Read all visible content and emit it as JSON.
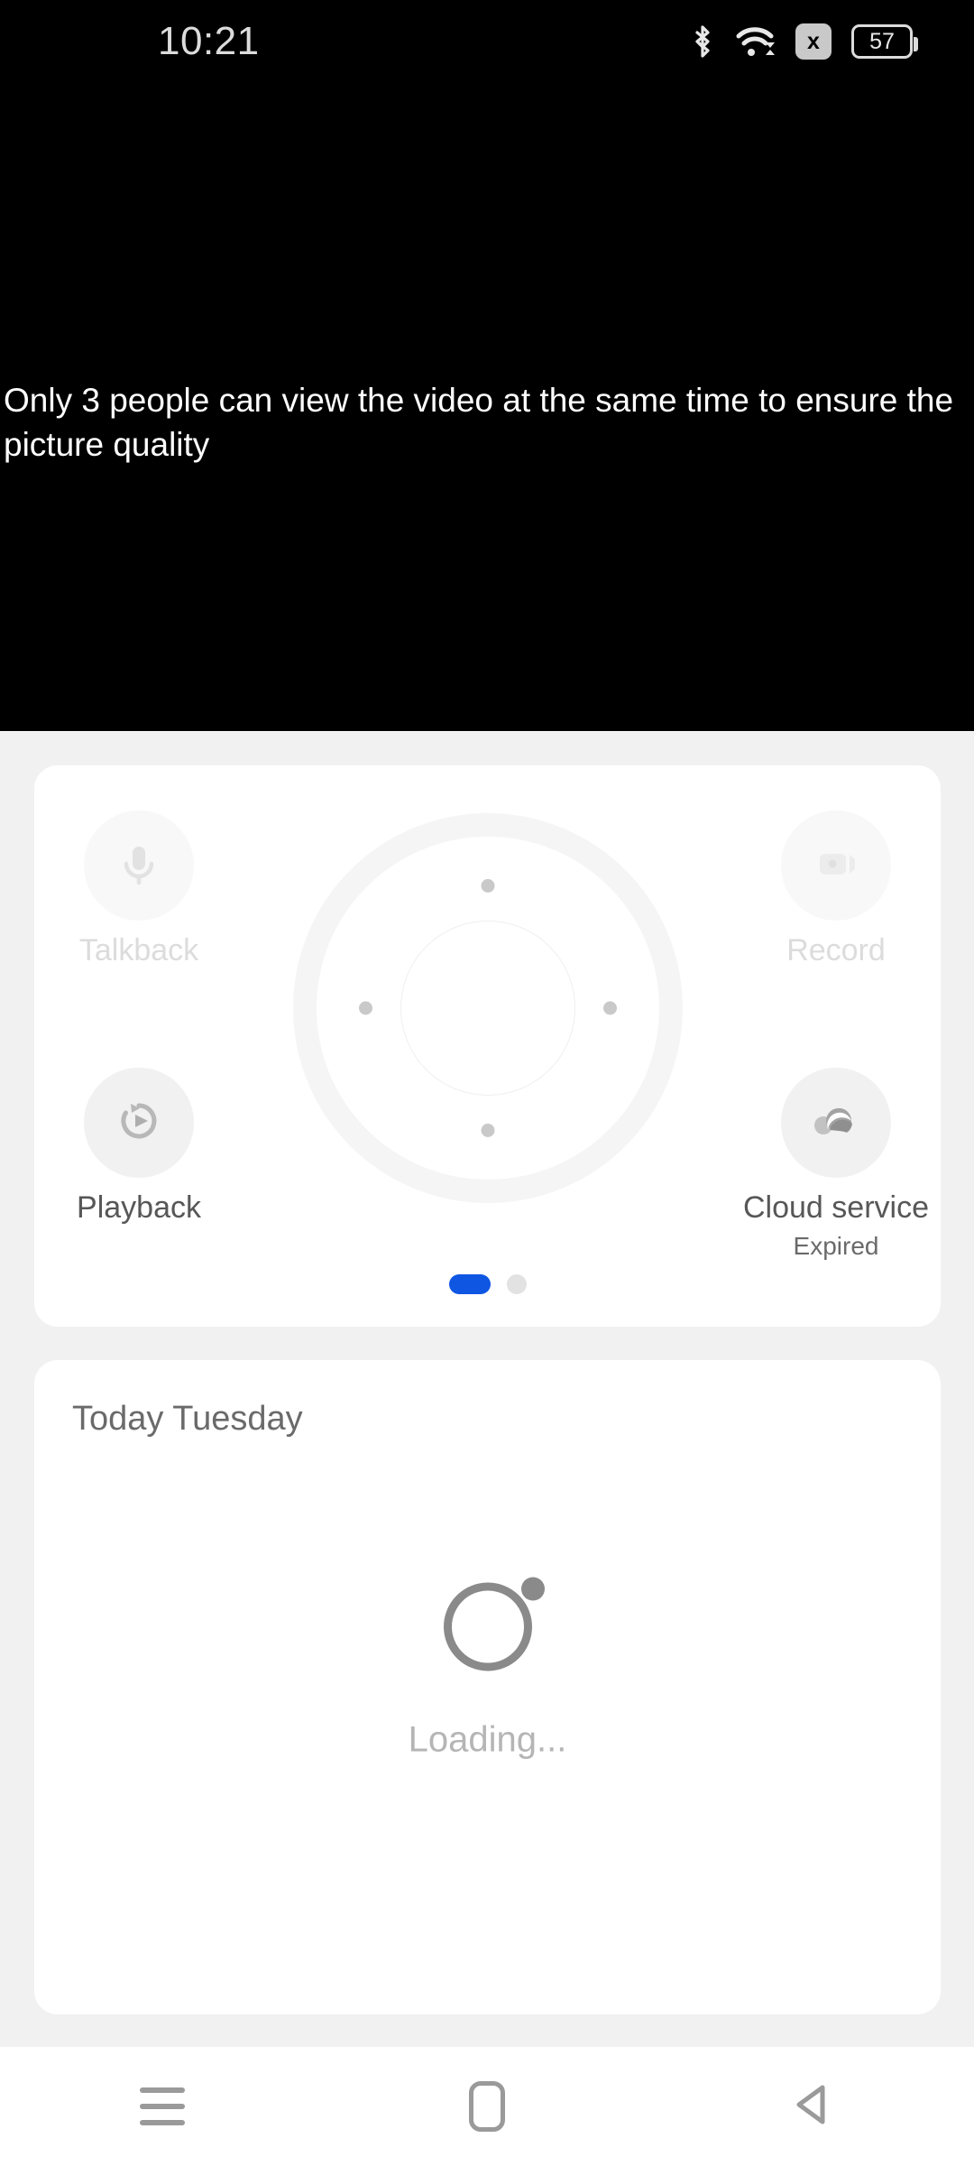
{
  "status_bar": {
    "time": "10:21",
    "bluetooth_icon": "bluetooth-icon",
    "wifi_icon": "wifi-icon",
    "no_signal_icon": "x",
    "battery_level": "57"
  },
  "video": {
    "message": "Only 3 people can view the video at the same time to ensure the picture quality",
    "background_color": "#000000"
  },
  "controls": {
    "talkback": {
      "label": "Talkback",
      "icon": "microphone-icon",
      "state": "disabled"
    },
    "record": {
      "label": "Record",
      "icon": "video-camera-icon",
      "state": "disabled"
    },
    "playback": {
      "label": "Playback",
      "icon": "replay-play-icon",
      "state": "enabled"
    },
    "cloud": {
      "label": "Cloud service",
      "sublabel": "Expired",
      "icon": "cloud-icon",
      "state": "enabled"
    },
    "ptz": {
      "name": "pan-tilt-pad",
      "dots": 4
    },
    "pagination": {
      "pages": 2,
      "active_index": 0,
      "active_color": "#0f56e3",
      "inactive_color": "#e2e2e2"
    }
  },
  "timeline": {
    "title": "Today Tuesday",
    "loading_text": "Loading...",
    "spinner_color": "#8a8a8a"
  },
  "nav_bar": {
    "recents_label": "recents",
    "home_label": "home",
    "back_label": "back",
    "icon_color": "#9a9a9a"
  }
}
